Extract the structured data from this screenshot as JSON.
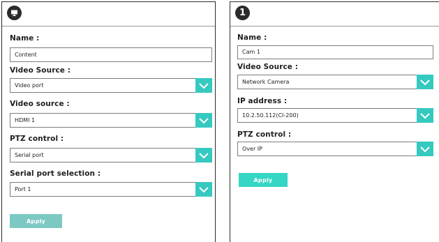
{
  "left_panel": {
    "badge_icon": "monitor-icon",
    "name_label": "Name :",
    "name_value": "Content",
    "video_source_label": "Video Source :",
    "video_source_value": "Video port",
    "video_source2_label": "Video source :",
    "video_source2_value": "HDMI 1",
    "ptz_label": "PTZ control :",
    "ptz_value": "Serial port",
    "serial_label": "Serial port selection :",
    "serial_value": "Port 1",
    "apply_label": "Apply",
    "apply_color": "#7cc9c4"
  },
  "right_panel": {
    "badge_text": "1",
    "name_label": "Name :",
    "name_value": "Cam 1",
    "video_source_label": "Video Source :",
    "video_source_value": "Network Camera",
    "ip_label": "IP address :",
    "ip_value": "10.2.50.112(CI-200)",
    "ptz_label": "PTZ control :",
    "ptz_value": "Over IP",
    "apply_label": "Apply",
    "apply_color": "#35d6c4"
  },
  "colors": {
    "accent": "#35c9c0",
    "border": "#2a2a2a"
  }
}
